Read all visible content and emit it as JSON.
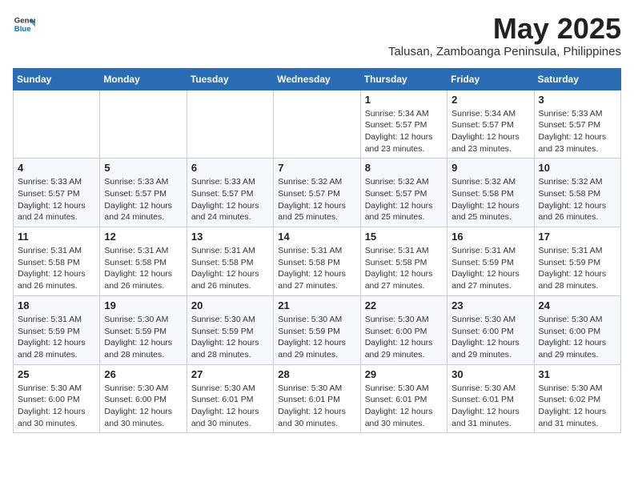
{
  "header": {
    "logo_general": "General",
    "logo_blue": "Blue",
    "month_title": "May 2025",
    "location": "Talusan, Zamboanga Peninsula, Philippines"
  },
  "weekdays": [
    "Sunday",
    "Monday",
    "Tuesday",
    "Wednesday",
    "Thursday",
    "Friday",
    "Saturday"
  ],
  "weeks": [
    [
      {
        "day": "",
        "info": ""
      },
      {
        "day": "",
        "info": ""
      },
      {
        "day": "",
        "info": ""
      },
      {
        "day": "",
        "info": ""
      },
      {
        "day": "1",
        "info": "Sunrise: 5:34 AM\nSunset: 5:57 PM\nDaylight: 12 hours\nand 23 minutes."
      },
      {
        "day": "2",
        "info": "Sunrise: 5:34 AM\nSunset: 5:57 PM\nDaylight: 12 hours\nand 23 minutes."
      },
      {
        "day": "3",
        "info": "Sunrise: 5:33 AM\nSunset: 5:57 PM\nDaylight: 12 hours\nand 23 minutes."
      }
    ],
    [
      {
        "day": "4",
        "info": "Sunrise: 5:33 AM\nSunset: 5:57 PM\nDaylight: 12 hours\nand 24 minutes."
      },
      {
        "day": "5",
        "info": "Sunrise: 5:33 AM\nSunset: 5:57 PM\nDaylight: 12 hours\nand 24 minutes."
      },
      {
        "day": "6",
        "info": "Sunrise: 5:33 AM\nSunset: 5:57 PM\nDaylight: 12 hours\nand 24 minutes."
      },
      {
        "day": "7",
        "info": "Sunrise: 5:32 AM\nSunset: 5:57 PM\nDaylight: 12 hours\nand 25 minutes."
      },
      {
        "day": "8",
        "info": "Sunrise: 5:32 AM\nSunset: 5:57 PM\nDaylight: 12 hours\nand 25 minutes."
      },
      {
        "day": "9",
        "info": "Sunrise: 5:32 AM\nSunset: 5:58 PM\nDaylight: 12 hours\nand 25 minutes."
      },
      {
        "day": "10",
        "info": "Sunrise: 5:32 AM\nSunset: 5:58 PM\nDaylight: 12 hours\nand 26 minutes."
      }
    ],
    [
      {
        "day": "11",
        "info": "Sunrise: 5:31 AM\nSunset: 5:58 PM\nDaylight: 12 hours\nand 26 minutes."
      },
      {
        "day": "12",
        "info": "Sunrise: 5:31 AM\nSunset: 5:58 PM\nDaylight: 12 hours\nand 26 minutes."
      },
      {
        "day": "13",
        "info": "Sunrise: 5:31 AM\nSunset: 5:58 PM\nDaylight: 12 hours\nand 26 minutes."
      },
      {
        "day": "14",
        "info": "Sunrise: 5:31 AM\nSunset: 5:58 PM\nDaylight: 12 hours\nand 27 minutes."
      },
      {
        "day": "15",
        "info": "Sunrise: 5:31 AM\nSunset: 5:58 PM\nDaylight: 12 hours\nand 27 minutes."
      },
      {
        "day": "16",
        "info": "Sunrise: 5:31 AM\nSunset: 5:59 PM\nDaylight: 12 hours\nand 27 minutes."
      },
      {
        "day": "17",
        "info": "Sunrise: 5:31 AM\nSunset: 5:59 PM\nDaylight: 12 hours\nand 28 minutes."
      }
    ],
    [
      {
        "day": "18",
        "info": "Sunrise: 5:31 AM\nSunset: 5:59 PM\nDaylight: 12 hours\nand 28 minutes."
      },
      {
        "day": "19",
        "info": "Sunrise: 5:30 AM\nSunset: 5:59 PM\nDaylight: 12 hours\nand 28 minutes."
      },
      {
        "day": "20",
        "info": "Sunrise: 5:30 AM\nSunset: 5:59 PM\nDaylight: 12 hours\nand 28 minutes."
      },
      {
        "day": "21",
        "info": "Sunrise: 5:30 AM\nSunset: 5:59 PM\nDaylight: 12 hours\nand 29 minutes."
      },
      {
        "day": "22",
        "info": "Sunrise: 5:30 AM\nSunset: 6:00 PM\nDaylight: 12 hours\nand 29 minutes."
      },
      {
        "day": "23",
        "info": "Sunrise: 5:30 AM\nSunset: 6:00 PM\nDaylight: 12 hours\nand 29 minutes."
      },
      {
        "day": "24",
        "info": "Sunrise: 5:30 AM\nSunset: 6:00 PM\nDaylight: 12 hours\nand 29 minutes."
      }
    ],
    [
      {
        "day": "25",
        "info": "Sunrise: 5:30 AM\nSunset: 6:00 PM\nDaylight: 12 hours\nand 30 minutes."
      },
      {
        "day": "26",
        "info": "Sunrise: 5:30 AM\nSunset: 6:00 PM\nDaylight: 12 hours\nand 30 minutes."
      },
      {
        "day": "27",
        "info": "Sunrise: 5:30 AM\nSunset: 6:01 PM\nDaylight: 12 hours\nand 30 minutes."
      },
      {
        "day": "28",
        "info": "Sunrise: 5:30 AM\nSunset: 6:01 PM\nDaylight: 12 hours\nand 30 minutes."
      },
      {
        "day": "29",
        "info": "Sunrise: 5:30 AM\nSunset: 6:01 PM\nDaylight: 12 hours\nand 30 minutes."
      },
      {
        "day": "30",
        "info": "Sunrise: 5:30 AM\nSunset: 6:01 PM\nDaylight: 12 hours\nand 31 minutes."
      },
      {
        "day": "31",
        "info": "Sunrise: 5:30 AM\nSunset: 6:02 PM\nDaylight: 12 hours\nand 31 minutes."
      }
    ]
  ]
}
